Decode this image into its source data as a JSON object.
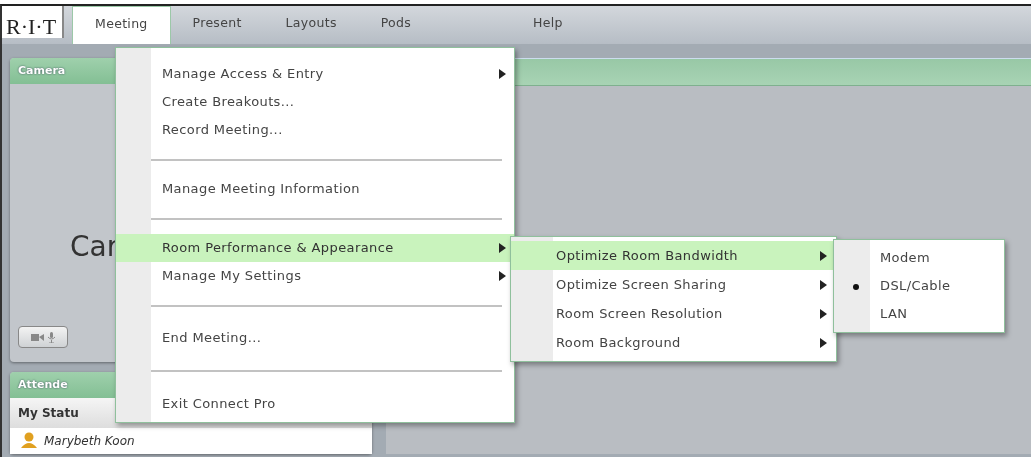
{
  "logo": "R·I·T",
  "menubar": [
    {
      "label": "Meeting",
      "selected": true
    },
    {
      "label": "Present",
      "selected": false
    },
    {
      "label": "Layouts",
      "selected": false
    },
    {
      "label": "Pods",
      "selected": false
    },
    {
      "label": "Help",
      "selected": false
    }
  ],
  "camera_pod": {
    "title": "Camera",
    "placeholder_text": "Car"
  },
  "attendees_pod": {
    "title": "Attende",
    "column_header": "My Statu",
    "attendees": [
      {
        "name": "Marybeth Koon"
      }
    ]
  },
  "meeting_menu": [
    {
      "kind": "item",
      "label": "Manage Access & Entry",
      "submenu": true,
      "highlighted": false
    },
    {
      "kind": "item",
      "label": "Create Breakouts...",
      "submenu": false,
      "highlighted": false
    },
    {
      "kind": "item",
      "label": "Record Meeting...",
      "submenu": false,
      "highlighted": false
    },
    {
      "kind": "separator"
    },
    {
      "kind": "item",
      "label": "Manage Meeting Information",
      "submenu": false,
      "highlighted": false
    },
    {
      "kind": "separator"
    },
    {
      "kind": "item",
      "label": "Room Performance & Appearance",
      "submenu": true,
      "highlighted": true
    },
    {
      "kind": "item",
      "label": "Manage My Settings",
      "submenu": true,
      "highlighted": false
    },
    {
      "kind": "separator"
    },
    {
      "kind": "item",
      "label": "End Meeting...",
      "submenu": false,
      "highlighted": false
    },
    {
      "kind": "separator"
    },
    {
      "kind": "item",
      "label": "Exit Connect Pro",
      "submenu": false,
      "highlighted": false
    }
  ],
  "room_submenu": [
    {
      "label": "Optimize Room Bandwidth",
      "submenu": true,
      "highlighted": true
    },
    {
      "label": "Optimize Screen Sharing",
      "submenu": true,
      "highlighted": false
    },
    {
      "label": "Room Screen Resolution",
      "submenu": true,
      "highlighted": false
    },
    {
      "label": "Room Background",
      "submenu": true,
      "highlighted": false
    }
  ],
  "bandwidth_submenu": [
    {
      "label": "Modem",
      "selected": false
    },
    {
      "label": "DSL/Cable",
      "selected": true
    },
    {
      "label": "LAN",
      "selected": false
    }
  ]
}
